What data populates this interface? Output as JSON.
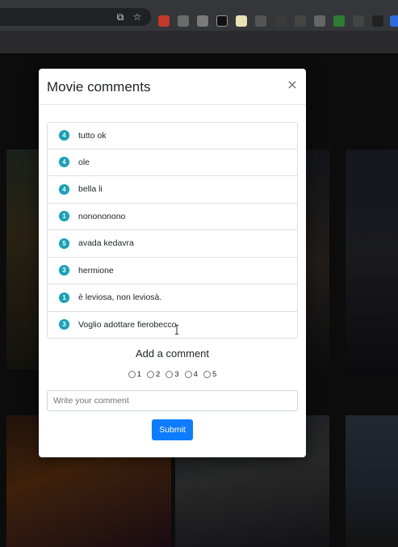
{
  "modal": {
    "title": "Movie comments",
    "close_label": "×",
    "comments": [
      {
        "rating": "4",
        "text": "tutto ok"
      },
      {
        "rating": "4",
        "text": "ole"
      },
      {
        "rating": "4",
        "text": "bella li"
      },
      {
        "rating": "1",
        "text": "nonononono"
      },
      {
        "rating": "5",
        "text": "avada kedavra"
      },
      {
        "rating": "3",
        "text": "hermione"
      },
      {
        "rating": "1",
        "text": "è leviosa, non leviosà."
      },
      {
        "rating": "3",
        "text": "Voglio adottare fierobecco"
      }
    ],
    "add_comment": {
      "heading": "Add a comment",
      "rating_options": [
        "1",
        "2",
        "3",
        "4",
        "5"
      ],
      "input_value": "",
      "input_placeholder": "Write your comment",
      "submit_label": "Submit"
    }
  },
  "colors": {
    "badge": "#17a2b8",
    "primary_button": "#0d7cff"
  },
  "browser": {
    "toolbar_icons": [
      "install-app-icon",
      "bookmark-star-icon",
      "extension-icons"
    ]
  }
}
